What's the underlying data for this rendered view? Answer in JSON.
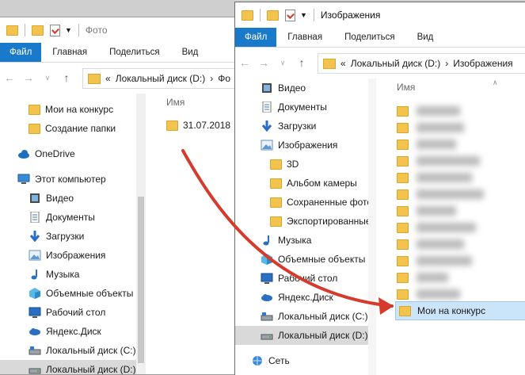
{
  "ribbon": {
    "file": "Файл",
    "home": "Главная",
    "share": "Поделиться",
    "view": "Вид"
  },
  "w1": {
    "title": "Фото",
    "breadcrumb": [
      "«",
      "Локальный диск (D:)",
      "›",
      "Фо"
    ],
    "column_name": "Имя",
    "file": "31.07.2018",
    "nav": [
      {
        "label": "Мои на конкурс",
        "icon": "folder-icon"
      },
      {
        "label": "Создание папки",
        "icon": "folder-icon"
      },
      {
        "label": "OneDrive",
        "icon": "cloud-icon"
      },
      {
        "label": "Этот компьютер",
        "icon": "computer-icon"
      },
      {
        "label": "Видео",
        "icon": "video-icon"
      },
      {
        "label": "Документы",
        "icon": "document-icon"
      },
      {
        "label": "Загрузки",
        "icon": "download-icon"
      },
      {
        "label": "Изображения",
        "icon": "pictures-icon"
      },
      {
        "label": "Музыка",
        "icon": "music-icon"
      },
      {
        "label": "Объемные объекты",
        "icon": "3d-objects-icon"
      },
      {
        "label": "Рабочий стол",
        "icon": "desktop-icon"
      },
      {
        "label": "Яндекс.Диск",
        "icon": "yandex-disk-icon"
      },
      {
        "label": "Локальный диск (C:)",
        "icon": "drive-c-icon"
      },
      {
        "label": "Локальный диск (D:)",
        "icon": "drive-d-icon"
      }
    ]
  },
  "w2": {
    "title": "Изображения",
    "breadcrumb": [
      "«",
      "Локальный диск (D:)",
      "›",
      "Изображения"
    ],
    "column_name": "Имя",
    "new_folder": "Мои на конкурс",
    "nav": [
      {
        "label": "Видео",
        "icon": "video-icon"
      },
      {
        "label": "Документы",
        "icon": "document-icon"
      },
      {
        "label": "Загрузки",
        "icon": "download-icon"
      },
      {
        "label": "Изображения",
        "icon": "pictures-icon"
      },
      {
        "label": "3D",
        "icon": "folder-icon"
      },
      {
        "label": "Альбом камеры",
        "icon": "folder-icon"
      },
      {
        "label": "Сохраненные фото",
        "icon": "folder-icon"
      },
      {
        "label": "Экспортированные",
        "icon": "folder-icon"
      },
      {
        "label": "Музыка",
        "icon": "music-icon"
      },
      {
        "label": "Объемные объекты",
        "icon": "3d-objects-icon"
      },
      {
        "label": "Рабочий стол",
        "icon": "desktop-icon"
      },
      {
        "label": "Яндекс.Диск",
        "icon": "yandex-disk-icon"
      },
      {
        "label": "Локальный диск (C:)",
        "icon": "drive-c-icon"
      },
      {
        "label": "Локальный диск (D:)",
        "icon": "drive-d-icon"
      },
      {
        "label": "Сеть",
        "icon": "network-icon"
      }
    ]
  },
  "colors": {
    "accent": "#1979ca",
    "folder": "#f2c44d",
    "selection": "#cce4f7",
    "arrow": "#d63a2c"
  }
}
